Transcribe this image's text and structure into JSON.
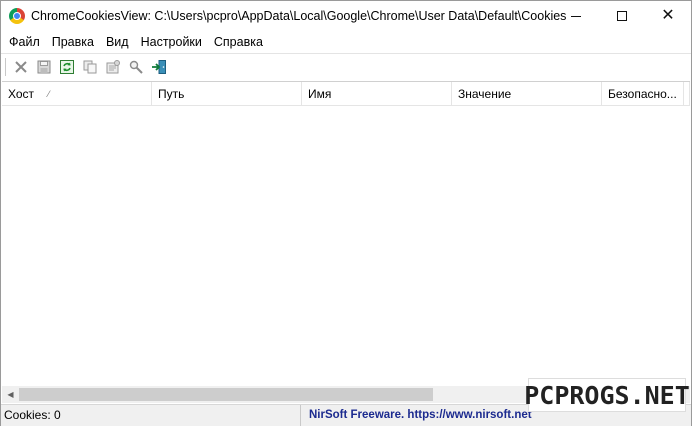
{
  "window": {
    "title": "ChromeCookiesView:  C:\\Users\\pcpro\\AppData\\Local\\Google\\Chrome\\User Data\\Default\\Cookies",
    "controls": {
      "minimize": "minimize-icon",
      "maximize": "maximize-icon",
      "close": "close-icon"
    }
  },
  "menu": {
    "items": [
      {
        "label": "Файл"
      },
      {
        "label": "Правка"
      },
      {
        "label": "Вид"
      },
      {
        "label": "Настройки"
      },
      {
        "label": "Справка"
      }
    ]
  },
  "toolbar": {
    "buttons": [
      {
        "icon": "delete-icon"
      },
      {
        "icon": "save-icon"
      },
      {
        "icon": "refresh-icon"
      },
      {
        "icon": "copy-icon"
      },
      {
        "icon": "properties-icon"
      },
      {
        "icon": "find-icon"
      },
      {
        "icon": "exit-icon"
      }
    ]
  },
  "table": {
    "columns": [
      {
        "label": "Хост"
      },
      {
        "label": "Путь"
      },
      {
        "label": "Имя"
      },
      {
        "label": "Значение"
      },
      {
        "label": "Безопасно..."
      }
    ],
    "rows": []
  },
  "statusbar": {
    "count": "Cookies: 0",
    "link": "NirSoft Freeware. https://www.nirsoft.net"
  },
  "watermark": {
    "text": "PCPROGS.NET"
  },
  "colors": {
    "link": "#1b2a8f",
    "statusbar_bg": "#f0f0f0",
    "scroll_thumb": "#cdcdcd"
  }
}
